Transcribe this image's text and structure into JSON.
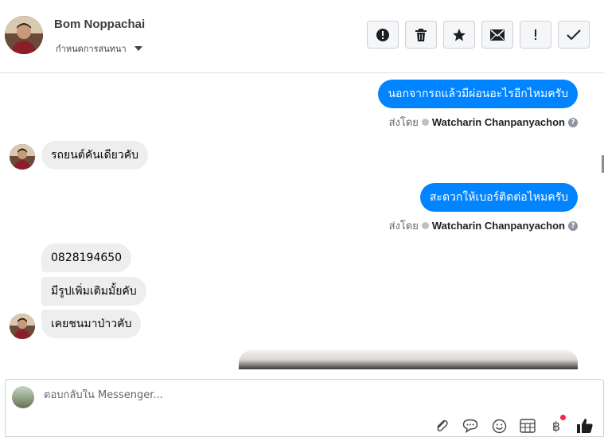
{
  "header": {
    "contact_name": "Bom Noppachai",
    "conversation_actions_label": "กำหนดการสนทนา",
    "toolbar": [
      {
        "name": "mark-spam-button",
        "icon": "alert-circle-icon"
      },
      {
        "name": "delete-button",
        "icon": "trash-icon"
      },
      {
        "name": "star-button",
        "icon": "star-icon"
      },
      {
        "name": "mark-unread-button",
        "icon": "envelope-icon"
      },
      {
        "name": "important-button",
        "icon": "exclamation-icon"
      },
      {
        "name": "mark-done-button",
        "icon": "check-icon"
      }
    ]
  },
  "messages": {
    "out_1": {
      "text": "นอกจากรถแล้วมีผ่อนอะไรอีกไหมครับ",
      "sent_by_prefix": "ส่งโดย",
      "sender": "Watcharin Chanpanyachon"
    },
    "in_1": {
      "text": "รถยนต์คันเดียวคับ"
    },
    "out_2": {
      "text": "สะดวกให้เบอร์ติดต่อไหมครับ",
      "sent_by_prefix": "ส่งโดย",
      "sender": "Watcharin Chanpanyachon"
    },
    "in_2": {
      "text": "0828194650"
    },
    "in_3": {
      "text": "มีรูปเพิ่มเติมมั้ยคับ"
    },
    "in_4": {
      "text": "เคยชนมาป่าวคับ"
    }
  },
  "composer": {
    "placeholder": "ตอบกลับใน Messenger...",
    "tools": [
      "paperclip-icon",
      "saved-reply-icon",
      "emoji-icon",
      "appointment-icon",
      "payment-icon",
      "like-icon"
    ],
    "payment_symbol": "฿",
    "colors": {
      "accent": "#0084ff",
      "notification": "#f02849"
    }
  }
}
